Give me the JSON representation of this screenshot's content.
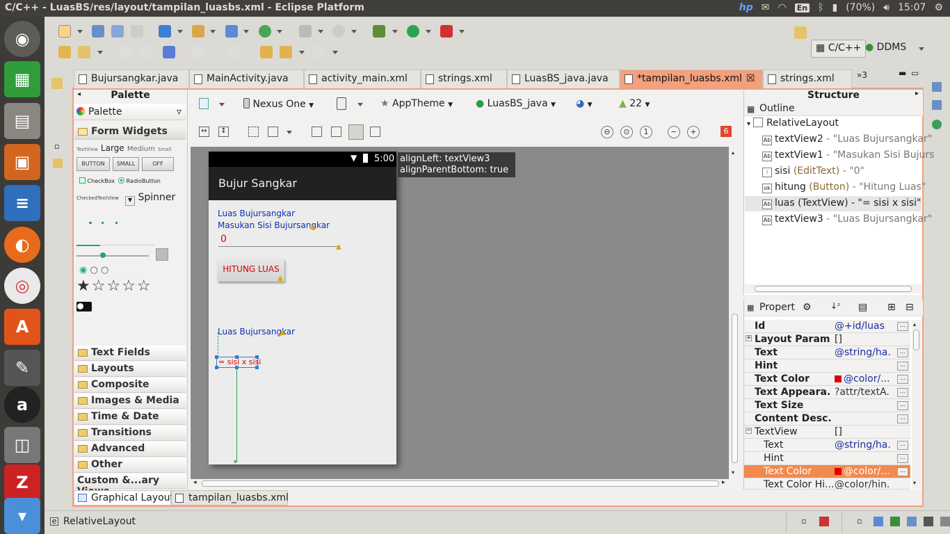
{
  "os_bar": {
    "window_title": "C/C++ - LuasBS/res/layout/tampilan_luasbs.xml - Eclipse Platform",
    "keyboard": "En",
    "battery": "(70%)",
    "clock": "15:07"
  },
  "perspectives": {
    "cpp": "C/C++",
    "ddms": "DDMS"
  },
  "editor_tabs": [
    {
      "label": "Bujursangkar.java",
      "active": false
    },
    {
      "label": "MainActivity.java",
      "active": false
    },
    {
      "label": "activity_main.xml",
      "active": false
    },
    {
      "label": "strings.xml",
      "active": false
    },
    {
      "label": "LuasBS_java.java",
      "active": false
    },
    {
      "label": "*tampilan_luasbs.xml",
      "active": true
    },
    {
      "label": "strings.xml",
      "active": false
    }
  ],
  "tab_overflow": "»3",
  "palette": {
    "title": "Palette",
    "dropdown": "Palette",
    "form_widgets": "Form Widgets",
    "text_sizes": {
      "tv": "TextView",
      "large": "Large",
      "medium": "Medium",
      "small": "Small"
    },
    "buttons": {
      "button": "BUTTON",
      "small": "SMALL",
      "off": "OFF"
    },
    "checkbox": "CheckBox",
    "radio": "RadioButton",
    "checked_tv": "CheckedTextView",
    "spinner": "Spinner",
    "categories": [
      "Text Fields",
      "Layouts",
      "Composite",
      "Images & Media",
      "Time & Date",
      "Transitions",
      "Advanced",
      "Other",
      "Custom &...ary Views"
    ]
  },
  "canvas_toolbar": {
    "device": "Nexus One",
    "theme": "AppTheme",
    "activity": "LuasBS_java",
    "api": "22",
    "error_count": "6"
  },
  "device": {
    "time": "5:00",
    "app_title": "Bujur Sangkar",
    "text_luas1": "Luas Bujursangkar",
    "text_masukan": "Masukan Sisi Bujursangkar",
    "edit_value": "0",
    "button_label": "HITUNG LUAS",
    "text_luas2": "Luas Bujursangkar",
    "result": "= sisi x sisi"
  },
  "tooltip": {
    "line1": "alignLeft: textView3",
    "line2": "alignParentBottom: true"
  },
  "structure": {
    "title": "Structure",
    "outline": "Outline",
    "root": "RelativeLayout",
    "items": [
      {
        "id": "textView2",
        "type": "",
        "value": " - \"Luas Bujursangkar\""
      },
      {
        "id": "textView1",
        "type": "",
        "value": " - \"Masukan Sisi Bujurs"
      },
      {
        "id": "sisi",
        "type": " (EditText)",
        "value": " - \"0\""
      },
      {
        "id": "hitung",
        "type": " (Button)",
        "value": " - \"Hitung Luas\""
      },
      {
        "id": "luas",
        "type": " (TextView)",
        "value": " - \"= sisi x sisi\""
      },
      {
        "id": "textView3",
        "type": "",
        "value": " - \"Luas Bujursangkar\""
      }
    ]
  },
  "properties": {
    "title": "Propert",
    "rows": [
      {
        "key": "Id",
        "value": "@+id/luas",
        "bold": true,
        "swatch": false,
        "selected": false
      },
      {
        "key": "Layout Param...",
        "value": "[]",
        "bold": true,
        "swatch": false,
        "selected": false,
        "expander": true
      },
      {
        "key": "Text",
        "value": "@string/ha...",
        "bold": true,
        "swatch": false,
        "selected": false
      },
      {
        "key": "Hint",
        "value": "",
        "bold": true,
        "swatch": false,
        "selected": false
      },
      {
        "key": "Text Color",
        "value": "@color/...",
        "bold": true,
        "swatch": true,
        "selected": false
      },
      {
        "key": "Text Appeara...",
        "value": "?attr/textA...",
        "bold": true,
        "swatch": false,
        "selected": false
      },
      {
        "key": "Text Size",
        "value": "",
        "bold": true,
        "swatch": false,
        "selected": false
      },
      {
        "key": "Content Desc...",
        "value": "",
        "bold": true,
        "swatch": false,
        "selected": false
      },
      {
        "key": "TextView",
        "value": "[]",
        "bold": false,
        "swatch": false,
        "selected": false,
        "expander": true,
        "section": true
      },
      {
        "key": "Text",
        "value": "@string/ha...",
        "bold": false,
        "swatch": false,
        "selected": false
      },
      {
        "key": "Hint",
        "value": "",
        "bold": false,
        "swatch": false,
        "selected": false
      },
      {
        "key": "Text Color",
        "value": "@color/...",
        "bold": false,
        "swatch": true,
        "selected": true
      },
      {
        "key": "Text Color Hi...",
        "value": "@color/hin...",
        "bold": false,
        "swatch": false,
        "selected": false
      }
    ]
  },
  "bottom_tabs": {
    "graphical": "Graphical Layout",
    "xml": "tampilan_luasbs.xml"
  },
  "status": {
    "selection": "RelativeLayout"
  },
  "colors": {
    "accent_orange": "#f1a07f",
    "selection_orange": "#f2894e",
    "text_blue": "#0f2fb0",
    "error_red": "#e00000"
  }
}
